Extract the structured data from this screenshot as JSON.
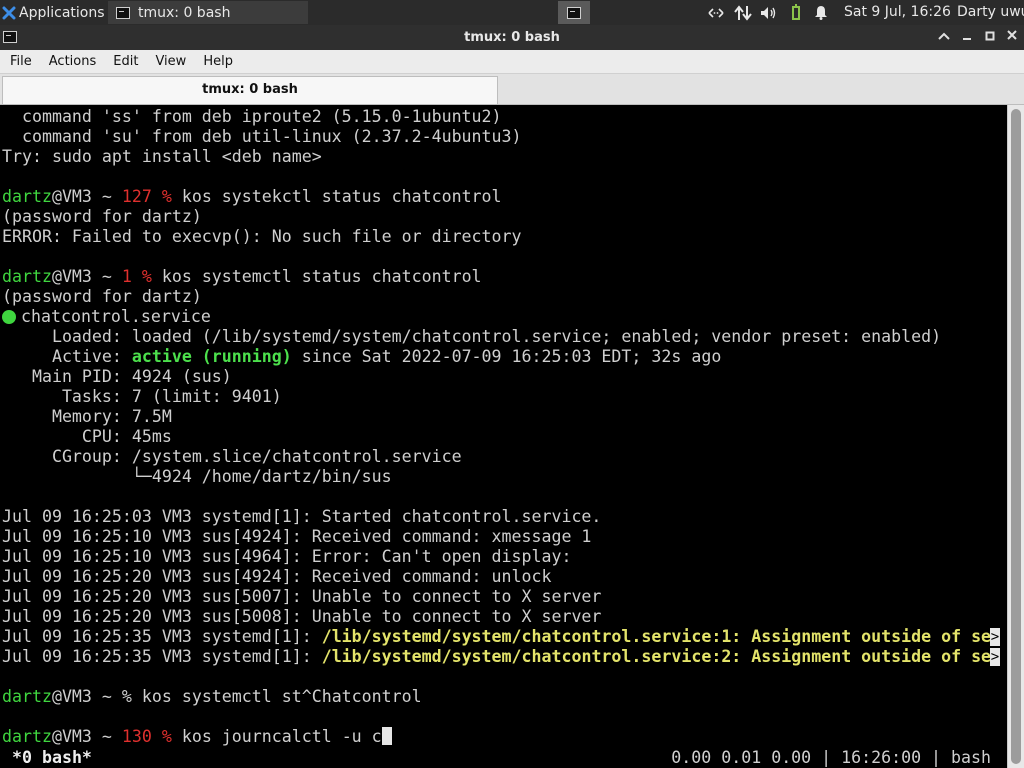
{
  "panel": {
    "applications_label": "Applications",
    "task_label": "tmux: 0 bash",
    "clock": "Sat  9 Jul, 16:26",
    "user": "Darty uwu",
    "colors": {
      "panel_bg": "#2b2b2b",
      "battery": "#8bc34a"
    }
  },
  "window": {
    "title": "tmux: 0 bash"
  },
  "menubar": {
    "items": [
      "File",
      "Actions",
      "Edit",
      "View",
      "Help"
    ]
  },
  "tab": {
    "label": "tmux: 0 bash"
  },
  "terminal": {
    "colors": {
      "fg": "#cfcfcf",
      "green": "#3fd63f",
      "red": "#e0302e",
      "yellow": "#e3e36a"
    },
    "lines": [
      {
        "text": "  command 'ss' from deb iproute2 (5.15.0-1ubuntu2)"
      },
      {
        "text": "  command 'su' from deb util-linux (2.37.2-4ubuntu3)"
      },
      {
        "text": "Try: sudo apt install <deb name>"
      },
      {
        "user": "dartz",
        "host": "@VM3 ~ ",
        "code": "127 % ",
        "cmd": "kos systekctl status chatcontrol"
      },
      {
        "text": "(password for dartz)"
      },
      {
        "text": "ERROR: Failed to execvp(): No such file or directory"
      },
      {
        "user": "dartz",
        "host": "@VM3 ~ ",
        "code": "1 % ",
        "cmd": "kos systemctl status chatcontrol"
      },
      {
        "text": "(password for dartz)"
      },
      {
        "service": "chatcontrol.service"
      },
      {
        "text": "     Loaded: loaded (/lib/systemd/system/chatcontrol.service; enabled; vendor preset: enabled)"
      },
      {
        "label": "     Active: ",
        "status": "active (running)",
        "rest": " since Sat 2022-07-09 16:25:03 EDT; 32s ago"
      },
      {
        "text": "   Main PID: 4924 (sus)"
      },
      {
        "text": "      Tasks: 7 (limit: 9401)"
      },
      {
        "text": "     Memory: 7.5M"
      },
      {
        "text": "        CPU: 45ms"
      },
      {
        "text": "     CGroup: /system.slice/chatcontrol.service"
      },
      {
        "text": "             └─4924 /home/dartz/bin/sus"
      },
      {
        "text": "Jul 09 16:25:03 VM3 systemd[1]: Started chatcontrol.service."
      },
      {
        "text": "Jul 09 16:25:10 VM3 sus[4924]: Received command: xmessage 1"
      },
      {
        "text": "Jul 09 16:25:10 VM3 sus[4964]: Error: Can't open display:"
      },
      {
        "text": "Jul 09 16:25:20 VM3 sus[4924]: Received command: unlock"
      },
      {
        "text": "Jul 09 16:25:20 VM3 sus[5007]: Unable to connect to X server"
      },
      {
        "text": "Jul 09 16:25:20 VM3 sus[5008]: Unable to connect to X server"
      },
      {
        "prefix": "Jul 09 16:25:35 VM3 systemd[1]: ",
        "warn": "/lib/systemd/system/chatcontrol.service:1: Assignment outside of se"
      },
      {
        "prefix": "Jul 09 16:25:35 VM3 systemd[1]: ",
        "warn": "/lib/systemd/system/chatcontrol.service:2: Assignment outside of se"
      },
      {
        "user": "dartz",
        "host": "@VM3 ~ % ",
        "cmd": "kos systemctl st^Chatcontrol"
      },
      {
        "user": "dartz",
        "host": "@VM3 ~ ",
        "code": "130 % ",
        "cmd": "kos journcalctl -u c"
      }
    ],
    "truncation_marker": ">"
  },
  "statusbar": {
    "left": "*0 bash*",
    "right": "0.00 0.01 0.00 | 16:26:00 | bash"
  }
}
